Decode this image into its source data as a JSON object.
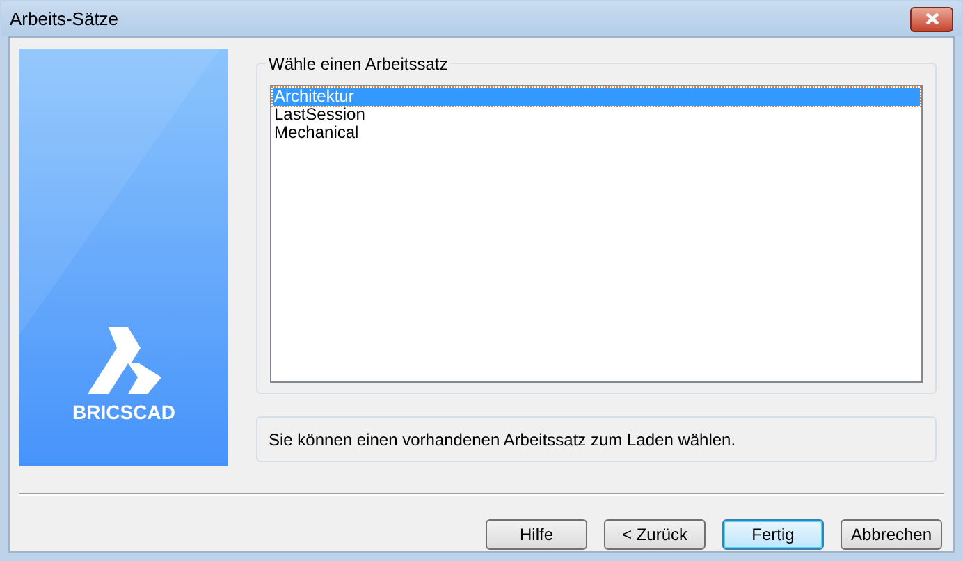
{
  "window": {
    "title": "Arbeits-Sätze"
  },
  "logo": {
    "text": "BRICSCAD"
  },
  "group": {
    "title": "Wähle einen Arbeitssatz",
    "items": [
      {
        "label": "Architektur",
        "selected": true
      },
      {
        "label": "LastSession",
        "selected": false
      },
      {
        "label": "Mechanical",
        "selected": false
      }
    ]
  },
  "info": "Sie können einen vorhandenen Arbeitssatz zum Laden wählen.",
  "buttons": [
    {
      "label": "Hilfe",
      "default": false
    },
    {
      "label": "< Zurück",
      "default": false
    },
    {
      "label": "Fertig",
      "default": true
    },
    {
      "label": "Abbrechen",
      "default": false
    }
  ]
}
